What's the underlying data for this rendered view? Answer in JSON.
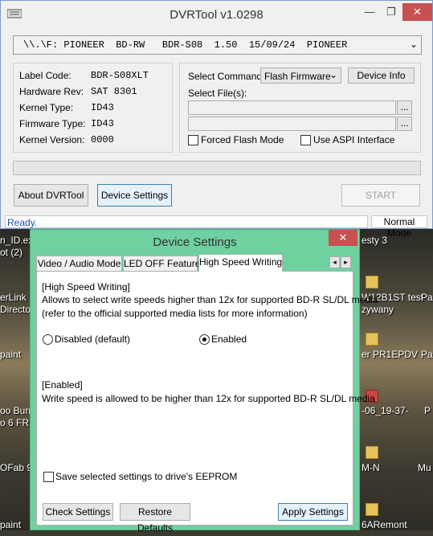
{
  "app": {
    "title": "DVRTool v1.0298",
    "minimize": "—",
    "restore": "❐",
    "close": "✕"
  },
  "drive": {
    "selected": "\\\\.\\F: PIONEER  BD-RW   BDR-S08  1.50  15/09/24  PIONEER"
  },
  "info": [
    {
      "label": "Label Code:",
      "value": "BDR-S08XLT"
    },
    {
      "label": "Hardware Rev:",
      "value": "SAT 8301"
    },
    {
      "label": "Kernel Type:",
      "value": "ID43"
    },
    {
      "label": "Firmware Type:",
      "value": "ID43"
    },
    {
      "label": "Kernel Version:",
      "value": "0000"
    }
  ],
  "command": {
    "select_label": "Select Command:",
    "selected": "Flash Firmware",
    "device_info": "Device Info",
    "select_files": "Select File(s):",
    "browse": "...",
    "forced_flash": "Forced Flash Mode",
    "use_aspi": "Use ASPI Interface"
  },
  "buttons": {
    "about": "About DVRTool",
    "device_settings": "Device Settings",
    "start": "START"
  },
  "status": {
    "text": "Ready.",
    "mode": "Normal Mode"
  },
  "desktop": {
    "texts": [
      "n_ID.ex",
      "ot (2)",
      "erLink",
      "Director",
      "paint",
      "oo Burn",
      "o 6 FRE",
      "OFab 9",
      "paint",
      "esty 3",
      "W12B1ST test",
      "zywany",
      "er PR1EPDV",
      "-06_19-37-",
      "M-N",
      "6ARemont",
      "Pa",
      "Pa",
      "P",
      "Mu"
    ]
  },
  "dialog": {
    "title": "Device Settings",
    "close": "✕",
    "tabs": [
      "Video / Audio Mode",
      "LED OFF Feature",
      "High Speed Writing"
    ],
    "active_tab": 2,
    "scroll_left": "◂",
    "scroll_right": "▸",
    "heading": "[High Speed Writing]",
    "desc1": "Allows to select write speeds higher than 12x for supported BD-R SL/DL media",
    "desc2": "(refer to the official supported media lists for more information)",
    "option_disabled": "Disabled (default)",
    "option_enabled": "Enabled",
    "selected_option": "Enabled",
    "enabled_heading": "[Enabled]",
    "enabled_desc": "Write speed is allowed to be higher than 12x for supported BD-R SL/DL media",
    "save_eeprom": "Save selected settings to drive's EEPROM",
    "check_settings": "Check Settings",
    "restore_defaults": "Restore Defaults",
    "apply_settings": "Apply Settings"
  }
}
